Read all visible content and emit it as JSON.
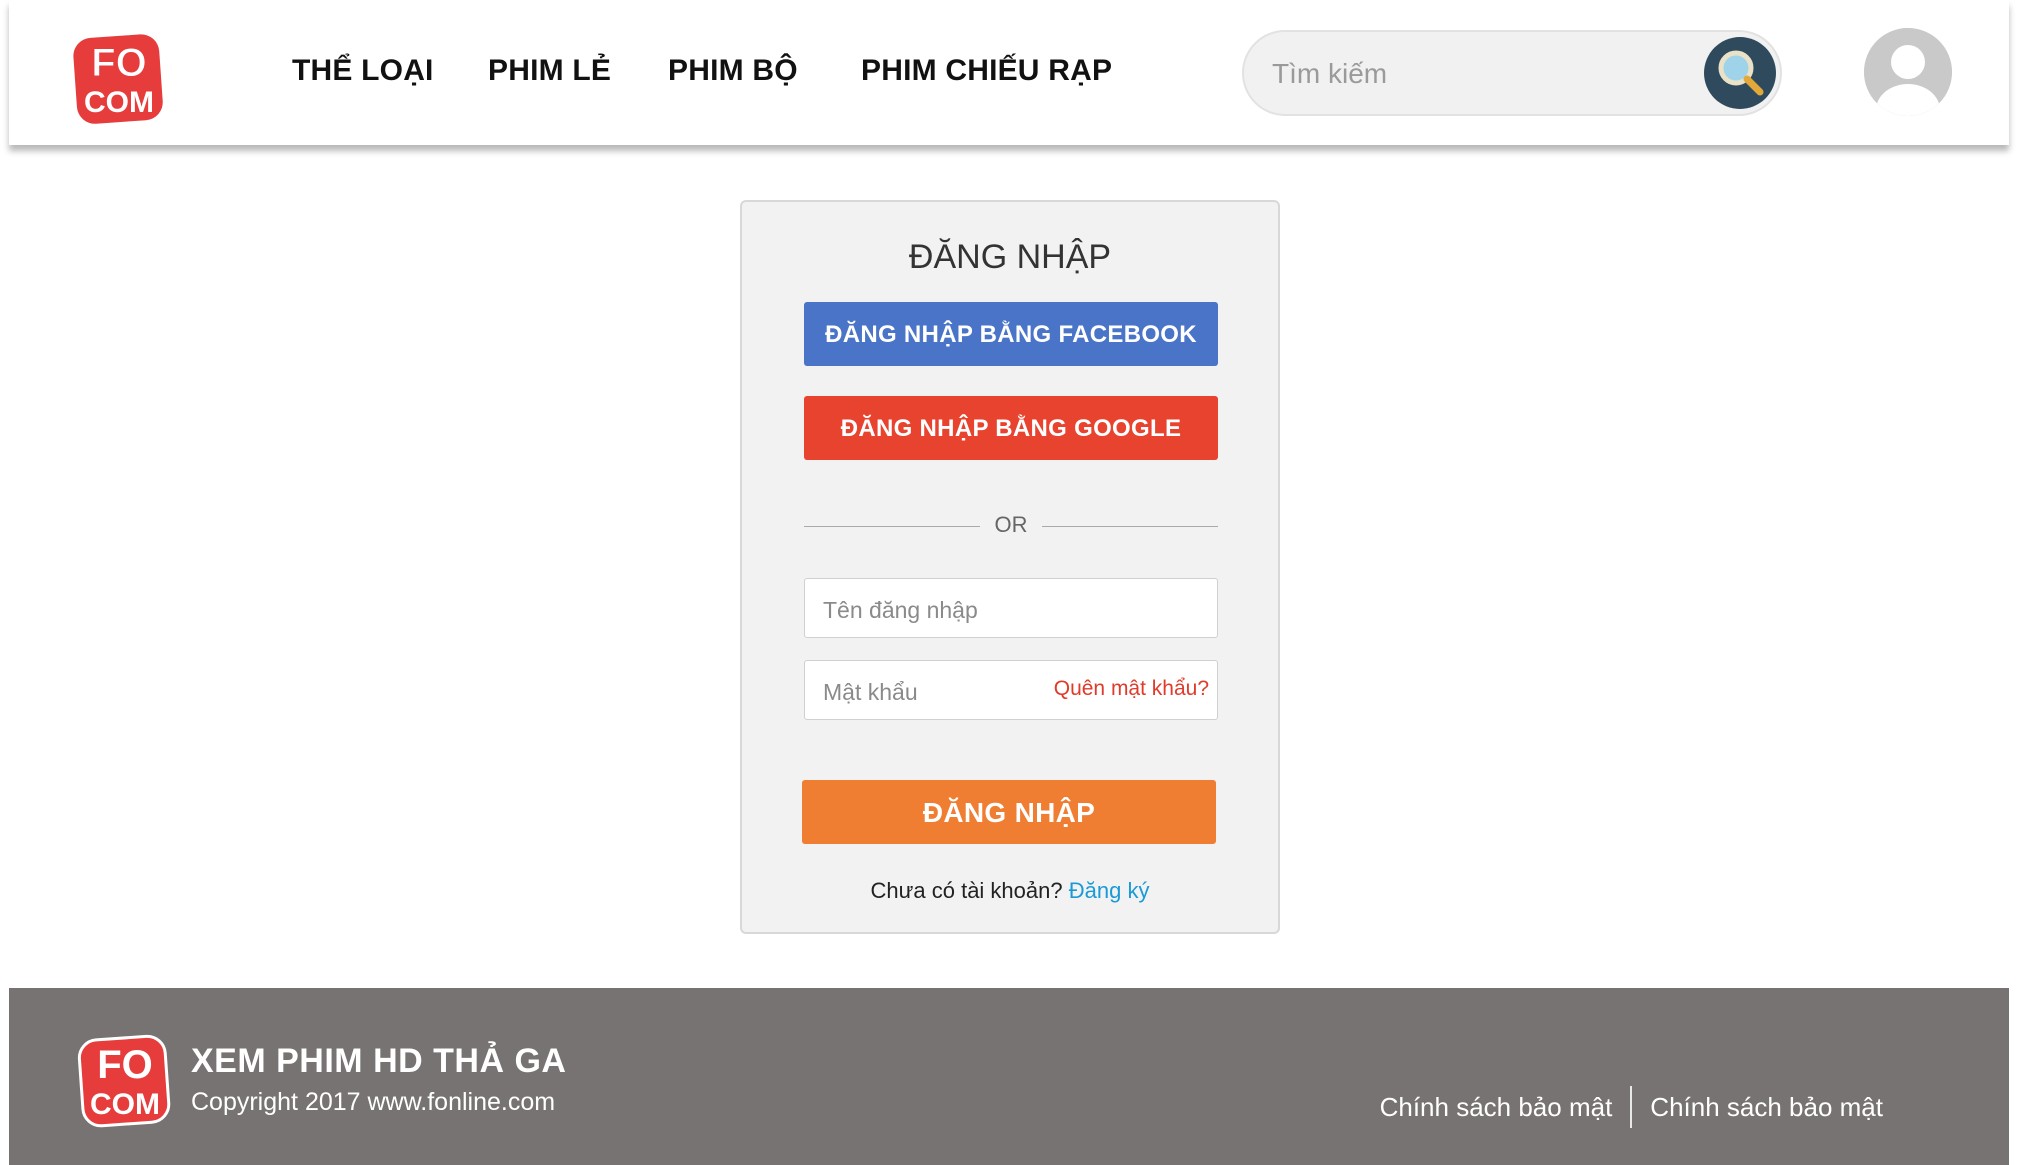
{
  "header": {
    "logo_top": "FO",
    "logo_bottom": "COM",
    "nav": [
      {
        "label": "THỂ LOẠI"
      },
      {
        "label": "PHIM LẺ"
      },
      {
        "label": "PHIM BỘ"
      },
      {
        "label": "PHIM CHIẾU RẠP"
      }
    ],
    "search": {
      "placeholder": "Tìm kiếm",
      "value": ""
    }
  },
  "login": {
    "title": "ĐĂNG NHẬP",
    "facebook_label": "ĐĂNG NHẬP BẰNG FACEBOOK",
    "google_label": "ĐĂNG NHẬP BẰNG GOOGLE",
    "or_text": "OR",
    "username_placeholder": "Tên đăng nhập",
    "password_placeholder": "Mật khẩu",
    "forgot_label": "Quên mật khẩu?",
    "submit_label": "ĐĂNG NHẬP",
    "no_account_text": "Chưa có tài khoản?",
    "register_label": "Đăng ký"
  },
  "footer": {
    "logo_top": "FO",
    "logo_bottom": "COM",
    "title": "XEM PHIM HD THẢ GA",
    "copyright": "Copyright 2017 www.fonline.com",
    "links": [
      {
        "label": "Chính sách bảo mật"
      },
      {
        "label": "Chính sách bảo mật"
      }
    ]
  },
  "colors": {
    "facebook": "#4a74c8",
    "google": "#e8432e",
    "login": "#ef7e33",
    "link": "#1a9ad6",
    "forgot": "#e03b2a",
    "footer_bg": "#777372",
    "logo_red": "#e63c3c"
  },
  "icons": [
    "logo-icon",
    "search-icon",
    "user-avatar-icon"
  ]
}
